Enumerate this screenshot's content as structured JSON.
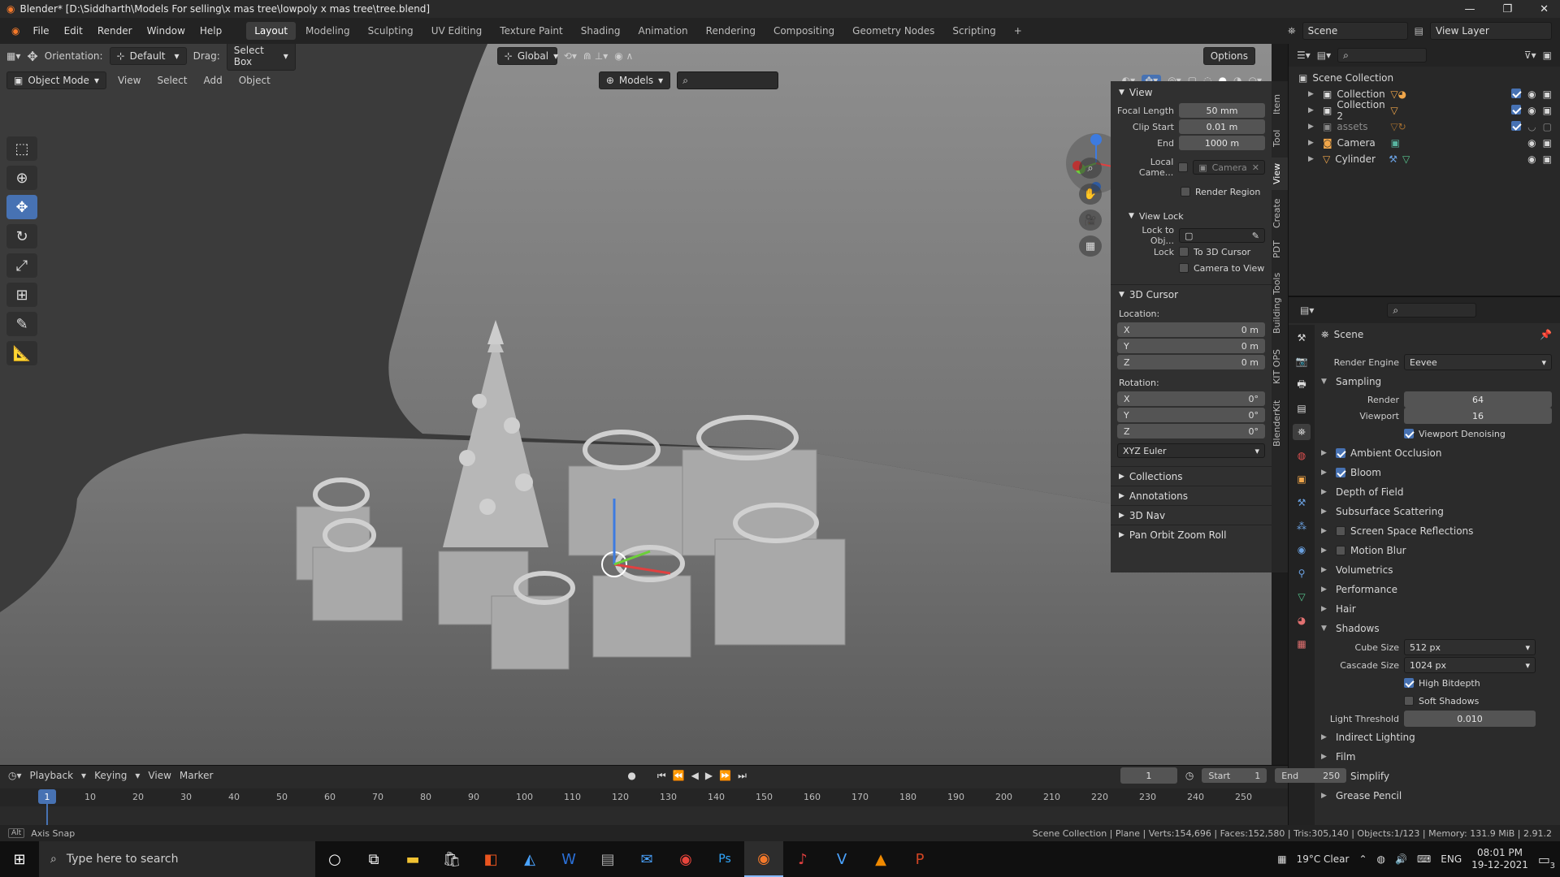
{
  "titlebar": {
    "title": "Blender* [D:\\Siddharth\\Models For selling\\x mas tree\\lowpoly x mas tree\\tree.blend]"
  },
  "menus": [
    "File",
    "Edit",
    "Render",
    "Window",
    "Help"
  ],
  "workspaces": [
    "Layout",
    "Modeling",
    "Sculpting",
    "UV Editing",
    "Texture Paint",
    "Shading",
    "Animation",
    "Rendering",
    "Compositing",
    "Geometry Nodes",
    "Scripting"
  ],
  "active_workspace": "Layout",
  "scene_field": "Scene",
  "view_layer_field": "View Layer",
  "vp_header": {
    "orientation_label": "Orientation:",
    "orientation_value": "Default",
    "drag_label": "Drag:",
    "drag_value": "Select Box",
    "transform_space": "Global",
    "options": "Options",
    "mode": "Object Mode",
    "view": "View",
    "select": "Select",
    "add": "Add",
    "object": "Object",
    "collection_filter": "Models"
  },
  "npanel": {
    "view_head": "View",
    "focal_label": "Focal Length",
    "focal_value": "50 mm",
    "clip_start_label": "Clip Start",
    "clip_start_value": "0.01 m",
    "end_label": "End",
    "end_value": "1000 m",
    "local_camera_label": "Local Came...",
    "local_camera_value": "Camera",
    "render_region": "Render Region",
    "view_lock_head": "View Lock",
    "lock_obj_label": "Lock to Obj...",
    "lock_label": "Lock",
    "to_cursor": "To 3D Cursor",
    "camera_to_view": "Camera to View",
    "cursor_head": "3D Cursor",
    "location_label": "Location:",
    "loc": [
      {
        "axis": "X",
        "value": "0 m"
      },
      {
        "axis": "Y",
        "value": "0 m"
      },
      {
        "axis": "Z",
        "value": "0 m"
      }
    ],
    "rotation_label": "Rotation:",
    "rot": [
      {
        "axis": "X",
        "value": "0°"
      },
      {
        "axis": "Y",
        "value": "0°"
      },
      {
        "axis": "Z",
        "value": "0°"
      }
    ],
    "rot_mode": "XYZ Euler",
    "collapsed": [
      "Collections",
      "Annotations",
      "3D Nav",
      "Pan Orbit Zoom Roll"
    ]
  },
  "vtabs": [
    "Item",
    "Tool",
    "View",
    "Create",
    "PDT",
    "Building Tools",
    "KIT OPS",
    "BlenderKit"
  ],
  "outliner": {
    "root": "Scene Collection",
    "items": [
      "Collection",
      "Collection 2",
      "assets",
      "Camera",
      "Cylinder"
    ]
  },
  "props": {
    "scene_label": "Scene",
    "render_engine_label": "Render Engine",
    "render_engine_value": "Eevee",
    "sampling": "Sampling",
    "render_label": "Render",
    "render_value": "64",
    "viewport_label": "Viewport",
    "viewport_value": "16",
    "viewport_denoising": "Viewport Denoising",
    "sections": [
      {
        "label": "Ambient Occlusion",
        "check": true
      },
      {
        "label": "Bloom",
        "check": true
      },
      {
        "label": "Depth of Field",
        "check": null
      },
      {
        "label": "Subsurface Scattering",
        "check": null
      },
      {
        "label": "Screen Space Reflections",
        "check": false
      },
      {
        "label": "Motion Blur",
        "check": false
      },
      {
        "label": "Volumetrics",
        "check": null
      },
      {
        "label": "Performance",
        "check": null
      },
      {
        "label": "Hair",
        "check": null
      }
    ],
    "shadows": "Shadows",
    "cube_size_label": "Cube Size",
    "cube_size_value": "512 px",
    "cascade_label": "Cascade Size",
    "cascade_value": "1024 px",
    "high_bitdepth": "High Bitdepth",
    "soft_shadows": "Soft Shadows",
    "light_threshold_label": "Light Threshold",
    "light_threshold_value": "0.010",
    "more_sections": [
      {
        "label": "Indirect Lighting",
        "check": null
      },
      {
        "label": "Film",
        "check": null
      },
      {
        "label": "Simplify",
        "check": false
      },
      {
        "label": "Grease Pencil",
        "check": null
      }
    ]
  },
  "timeline": {
    "playback": "Playback",
    "keying": "Keying",
    "view": "View",
    "marker": "Marker",
    "current_frame": "1",
    "start_label": "Start",
    "start_value": "1",
    "end_label": "End",
    "end_value": "250",
    "ticks": [
      "10",
      "20",
      "30",
      "40",
      "50",
      "60",
      "70",
      "80",
      "90",
      "100",
      "110",
      "120",
      "130",
      "140",
      "150",
      "160",
      "170",
      "180",
      "190",
      "200",
      "210",
      "220",
      "230",
      "240",
      "250"
    ],
    "frame_marker": "1"
  },
  "statusbar": {
    "left": "Axis Snap",
    "right": "Scene Collection | Plane | Verts:154,696 | Faces:152,580 | Tris:305,140 | Objects:1/123 | Memory: 131.9 MiB | 2.91.2"
  },
  "taskbar": {
    "search_placeholder": "Type here to search",
    "weather": "19°C  Clear",
    "lang": "ENG",
    "time": "08:01 PM",
    "date": "19-12-2021",
    "notif": "3"
  }
}
